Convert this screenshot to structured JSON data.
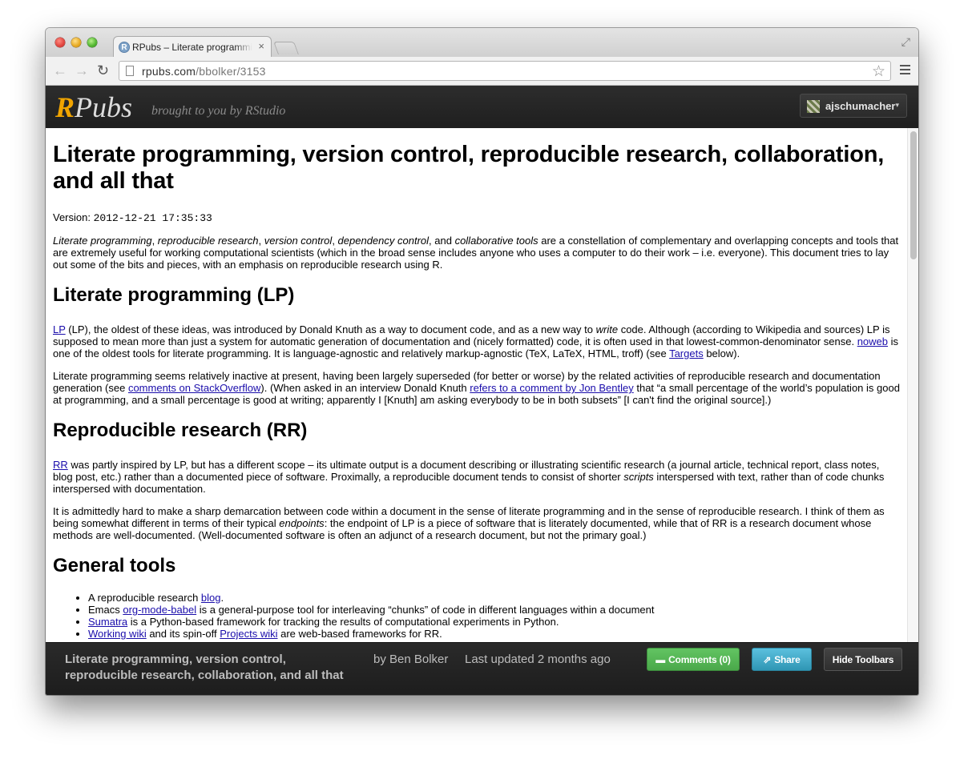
{
  "browser": {
    "tab_title": "RPubs – Literate programming, version control",
    "tab_close": "×",
    "url_host": "rpubs.com",
    "url_path": "/bbolker/3153"
  },
  "site": {
    "logo_r": "R",
    "logo_rest": "Pubs",
    "tagline": "brought to you by RStudio",
    "username": "ajschumacher",
    "caret": "▾"
  },
  "doc": {
    "title": "Literate programming, version control, reproducible research, collaboration, and all that",
    "version_label": "Version: ",
    "version_value": "2012-12-21 17:35:33",
    "intro": {
      "t1": "Literate programming",
      "s1": ", ",
      "t2": "reproducible research",
      "s2": ", ",
      "t3": "version control",
      "s3": ", ",
      "t4": "dependency control",
      "s4": ", and ",
      "t5": "collaborative tools",
      "rest": " are a constellation of complementary and overlapping concepts and tools that are extremely useful for working computational scientists (which in the broad sense includes anyone who uses a computer to do their work – i.e. everyone). This document tries to lay out some of the bits and pieces, with an emphasis on reproducible research using R."
    },
    "h_lp": "Literate programming (LP)",
    "lp1": {
      "link_lp": "LP",
      "a": " (LP), the oldest of these ideas, was introduced by Donald Knuth as a way to document code, and as a new way to ",
      "em_write": "write",
      "b": " code. Although (according to Wikipedia and sources) LP is supposed to mean more than just a system for automatic generation of documentation and (nicely formatted) code, it is often used in that lowest-common-denominator sense. ",
      "link_noweb": "noweb",
      "c": " is one of the oldest tools for literate programming. It is language-agnostic and relatively markup-agnostic (TeX, LaTeX, HTML, troff) (see ",
      "link_targets": "Targets",
      "d": " below)."
    },
    "lp2": {
      "a": "Literate programming seems relatively inactive at present, having been largely superseded (for better or worse) by the related activities of reproducible research and documentation generation (see ",
      "link_so": "comments on StackOverflow",
      "b": "). (When asked in an interview Donald Knuth ",
      "link_bentley": "refers to a comment by Jon Bentley",
      "c": " that “a small percentage of the world’s population is good at programming, and a small percentage is good at writing; apparently I [Knuth] am asking everybody to be in both subsets” [I can't find the original source].)"
    },
    "h_rr": "Reproducible research (RR)",
    "rr1": {
      "link_rr": "RR",
      "a": " was partly inspired by LP, but has a different scope – its ultimate output is a document describing or illustrating scientific research (a journal article, technical report, class notes, blog post, etc.) rather than a documented piece of software. Proximally, a reproducible document tends to consist of shorter ",
      "em_scripts": "scripts",
      "b": " interspersed with text, rather than of code chunks interspersed with documentation."
    },
    "rr2": {
      "a": "It is admittedly hard to make a sharp demarcation between code within a document in the sense of literate programming and in the sense of reproducible research. I think of them as being somewhat different in terms of their typical ",
      "em_endpoints": "endpoints",
      "b": ": the endpoint of LP is a piece of software that is literately documented, while that of RR is a research document whose methods are well-documented. (Well-documented software is often an adjunct of a research document, but not the primary goal.)"
    },
    "h_tools": "General tools",
    "tools": {
      "i1a": "A reproducible research ",
      "i1link": "blog",
      "i1b": ".",
      "i2a": "Emacs ",
      "i2link": "org-mode-babel",
      "i2b": " is a general-purpose tool for interleaving “chunks” of code in different languages within a document",
      "i3link": "Sumatra",
      "i3b": " is a Python-based framework for tracking the results of computational experiments in Python.",
      "i4link": "Working wiki",
      "i4b": " and its spin-off ",
      "i4link2": "Projects wiki",
      "i4c": " are web-based frameworks for RR."
    }
  },
  "footer": {
    "title": "Literate programming, version control, reproducible research, collaboration, and all that",
    "byline": "by Ben Bolker",
    "updated": "Last updated 2 months ago",
    "comments": "Comments (0)",
    "share": "Share",
    "hide": "Hide Toolbars"
  }
}
